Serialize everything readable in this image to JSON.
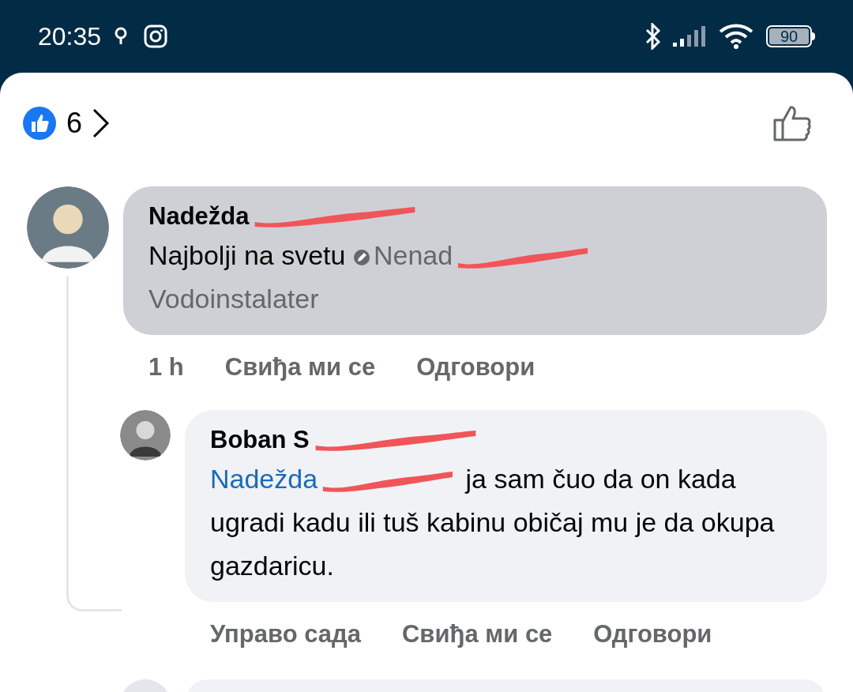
{
  "status_bar": {
    "time": "20:35",
    "battery": "90"
  },
  "reactions": {
    "count": "6"
  },
  "comments": [
    {
      "name": "Nadežda",
      "name_redacted": true,
      "highlighted": true,
      "body": [
        {
          "kind": "text",
          "text": "Najbolji na svetu"
        },
        {
          "kind": "tag",
          "text": "Nenad"
        },
        {
          "kind": "redaction"
        },
        {
          "kind": "muted_line",
          "text": "Vodoinstalater"
        }
      ],
      "time": "1 h",
      "actions": [
        "Свиђа ми се",
        "Одговори"
      ],
      "replies": [
        {
          "name": "Boban S",
          "name_redacted": true,
          "highlighted": false,
          "body": [
            {
              "kind": "mention",
              "text": "Nadežda"
            },
            {
              "kind": "redaction"
            },
            {
              "kind": "text",
              "text": "ja sam čuo da on kada ugradi kadu ili tuš kabinu običaj mu je da okupa gazdaricu."
            }
          ],
          "time": "Управо сада",
          "actions": [
            "Свиђа ми се",
            "Одговори"
          ]
        }
      ]
    }
  ]
}
